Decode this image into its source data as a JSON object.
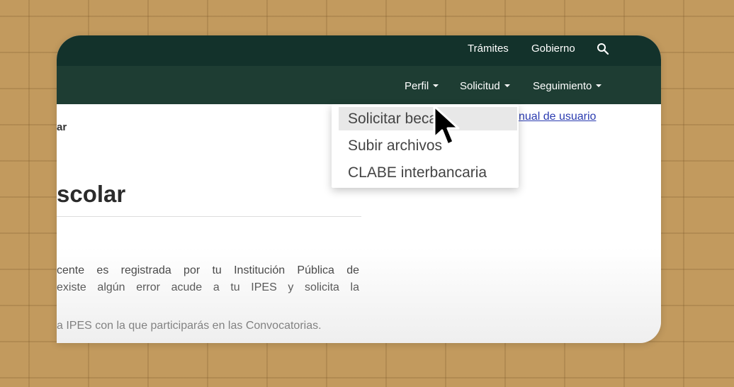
{
  "top_bar": {
    "links": [
      "Trámites",
      "Gobierno"
    ],
    "search_icon": "search-icon"
  },
  "nav": {
    "items": [
      "Perfil",
      "Solicitud",
      "Seguimiento"
    ]
  },
  "dropdown": {
    "items": [
      "Solicitar beca",
      "Subir archivos",
      "CLABE interbancaria"
    ],
    "hovered_index": 0
  },
  "content": {
    "breadcrumb": "ar",
    "heading": "scolar",
    "paragraph_lines": [
      "cente es registrada por tu Institución Pública de",
      "existe algún error acude a tu IPES y solicita la"
    ],
    "paragraph2": "a IPES con la que participarás en las Convocatorias.",
    "manual_link": "nual de usuario"
  },
  "colors": {
    "topbar": "#13322b",
    "navbar": "#1e3d33",
    "link": "#2a3bb0",
    "background": "#c29a5e"
  }
}
